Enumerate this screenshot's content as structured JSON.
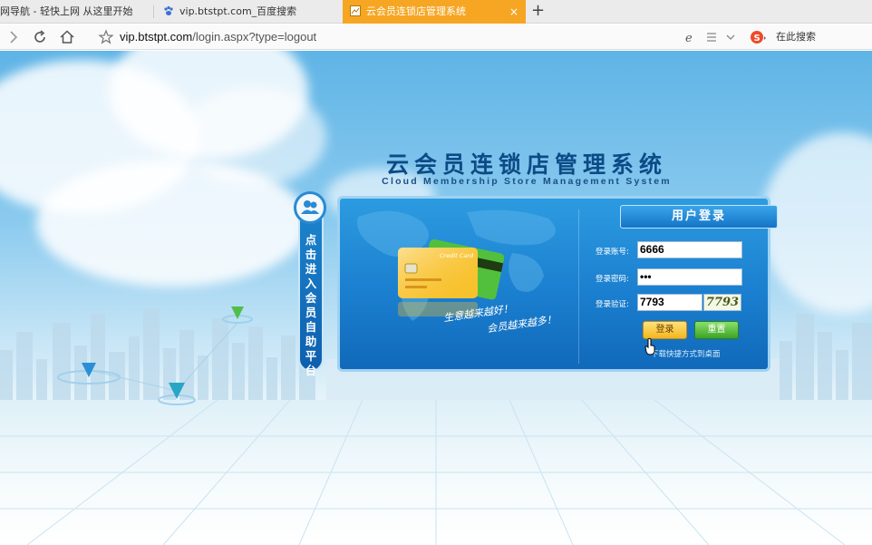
{
  "browser": {
    "tabs": [
      {
        "label": "网导航 - 轻快上网 从这里开始",
        "active": false
      },
      {
        "label": "vip.btstpt.com_百度搜索",
        "active": false
      },
      {
        "label": "云会员连锁店管理系统",
        "active": true
      }
    ],
    "new_tab_symbol": "+",
    "close_symbol": "×",
    "url_domain": "vip.btstpt.com",
    "url_path": "/login.aspx?type=logout",
    "search_placeholder": "在此搜索",
    "active_tab_color": "#f6a623"
  },
  "page": {
    "title": "云会员连锁店管理系统",
    "subtitle": "Cloud Membership Store Management System",
    "side_tab_text": [
      "点",
      "击",
      "进",
      "入",
      "会",
      "员",
      "自",
      "助",
      "平",
      "台"
    ],
    "credit_card_label": "Credit Card",
    "slogan_line1": "生意越来越好！",
    "slogan_line2": "会员越来越多！",
    "login": {
      "header": "用户登录",
      "account_label": "登录账号:",
      "account_value": "6666",
      "password_label": "登录密码:",
      "password_value": "•••",
      "captcha_label": "登录验证:",
      "captcha_value": "7793",
      "captcha_image_text": "7793",
      "login_button": "登录",
      "reset_button": "重置",
      "shortcut_link": "下载快捷方式到桌面"
    }
  }
}
